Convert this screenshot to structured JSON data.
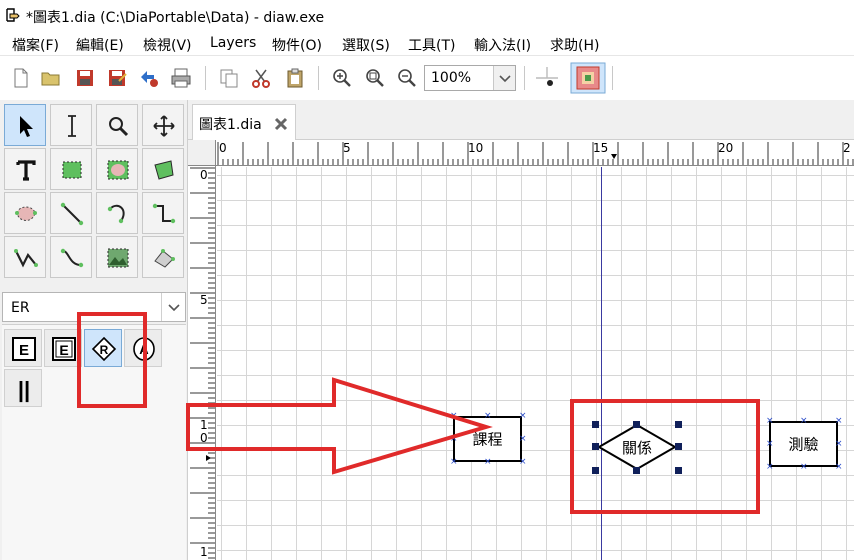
{
  "window": {
    "title": "*圖表1.dia (C:\\DiaPortable\\Data) - diaw.exe"
  },
  "menubar": {
    "items": [
      "檔案(F)",
      "編輯(E)",
      "檢視(V)",
      "Layers",
      "物件(O)",
      "選取(S)",
      "工具(T)",
      "輸入法(I)",
      "求助(H)"
    ]
  },
  "toolbar": {
    "zoom_value": "100%",
    "icons": [
      "new-file-icon",
      "open-folder-icon",
      "save-icon",
      "save-as-icon",
      "export-icon",
      "print-icon",
      "copy-icon",
      "cut-icon",
      "paste-icon",
      "zoom-in-icon",
      "zoom-fit-icon",
      "zoom-out-icon",
      "snap-to-grid-icon",
      "snap-to-objects-icon"
    ]
  },
  "toolbox": {
    "tools": [
      "pointer",
      "text-cursor",
      "magnify",
      "move-scroll",
      "text",
      "box",
      "ellipse",
      "polygon",
      "beziergon",
      "line",
      "arc",
      "zigzag-line",
      "polyline",
      "bezier-line",
      "image",
      "outline"
    ],
    "sheet_selected": "ER",
    "sheet_shapes": [
      "E",
      "E",
      "R",
      "A",
      "||"
    ]
  },
  "tab": {
    "label": "圖表1.dia"
  },
  "ruler": {
    "h_labels": [
      "0",
      "5",
      "10",
      "15",
      "20",
      "2"
    ],
    "v_labels": [
      "0",
      "5",
      "1\n0",
      "1"
    ]
  },
  "diagram": {
    "entities": [
      {
        "label": "課程"
      },
      {
        "label": "關係"
      },
      {
        "label": "測驗"
      }
    ]
  },
  "colors": {
    "annotation_red": "#e02a2a",
    "selection_handle": "#10205a",
    "guide_line": "#3a3aa0"
  }
}
